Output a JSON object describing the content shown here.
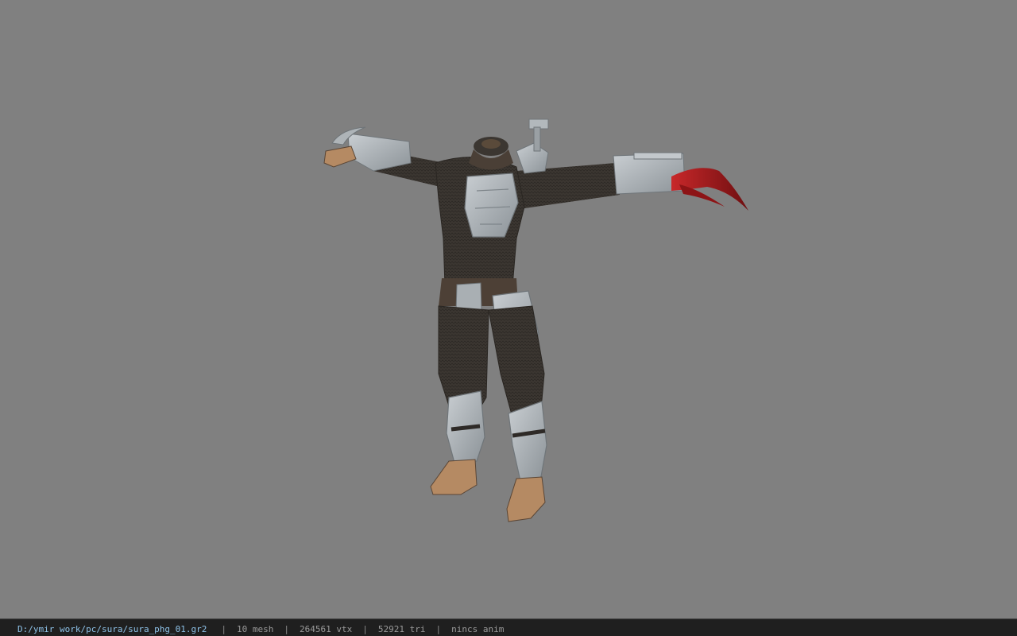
{
  "viewer": {
    "model_name": "sura_phg_01 character model (headless armored body, T-pose)"
  },
  "status_bar": {
    "file_path": "D:/ymir work/pc/sura/sura_phg_01.gr2",
    "separator": "|",
    "mesh_count": "10 mesh",
    "vertex_count": "264561 vtx",
    "triangle_count": "52921 tri",
    "anim": "nincs anim"
  },
  "colors": {
    "viewport_bg": "#808080",
    "status_bg": "#1f1f1f",
    "path_text": "#8ec2e8",
    "info_text": "#9a9a9a",
    "armor_plate": "#aeb4b8",
    "body_suit": "#3a3530",
    "claw_red": "#a3191b"
  }
}
